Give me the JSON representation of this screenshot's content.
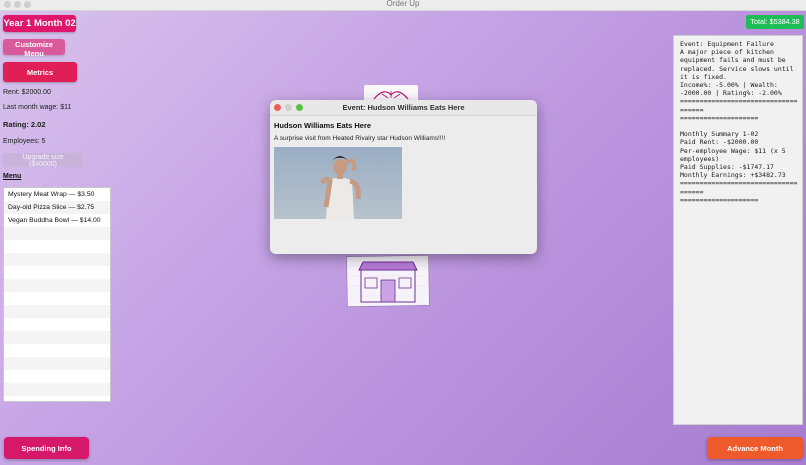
{
  "window": {
    "title": "Order Up"
  },
  "header": {
    "year_month": "Year 1  Month 02",
    "total": "Total: $5384.38"
  },
  "sidebar": {
    "customize_label": "Customize Menu",
    "metrics_label": "Metrics",
    "rent": "Rent: $2000.00",
    "last_wage": "Last month wage: $11",
    "rating": "Rating: 2.02",
    "employees": "Employees: 5",
    "upgrade_label": "Upgrade size ($40000)",
    "menu_title": "Menu",
    "menu_items": [
      "Mystery Meat Wrap — $3.50",
      "Day-old Pizza Slice — $2.75",
      "Vegan Buddha Bowl — $14.00"
    ]
  },
  "dialog": {
    "title": "Event: Hudson Williams Eats Here",
    "heading": "Hudson Williams Eats Here",
    "description": "A surprise visit from Heated Rivalry star Hudson Williams!!!!"
  },
  "log": {
    "text": "Event: Equipment Failure\nA major piece of kitchen equipment fails and must be replaced. Service slows until it is fixed.\nIncome%: -5.00% | Wealth: -2000.00 | Rating%: -2.00%\n====================================\n====================\n\nMonthly Summary 1-02\nPaid Rent: -$2000.00\nPer-employee Wage: $11 (x 5 employees)\nPaid Supplies: -$1747.17\nMonthly Earnings: +$3482.73\n====================================\n===================="
  },
  "footer": {
    "spending_label": "Spending Info",
    "advance_label": "Advance Month"
  },
  "colors": {
    "accent_pink": "#e0166d",
    "metrics_red": "#e01f57",
    "total_green": "#1fbd58",
    "advance_orange": "#ef5a2a"
  },
  "icons": [
    "close-dot-icon",
    "minimize-dot-icon",
    "zoom-dot-icon"
  ]
}
